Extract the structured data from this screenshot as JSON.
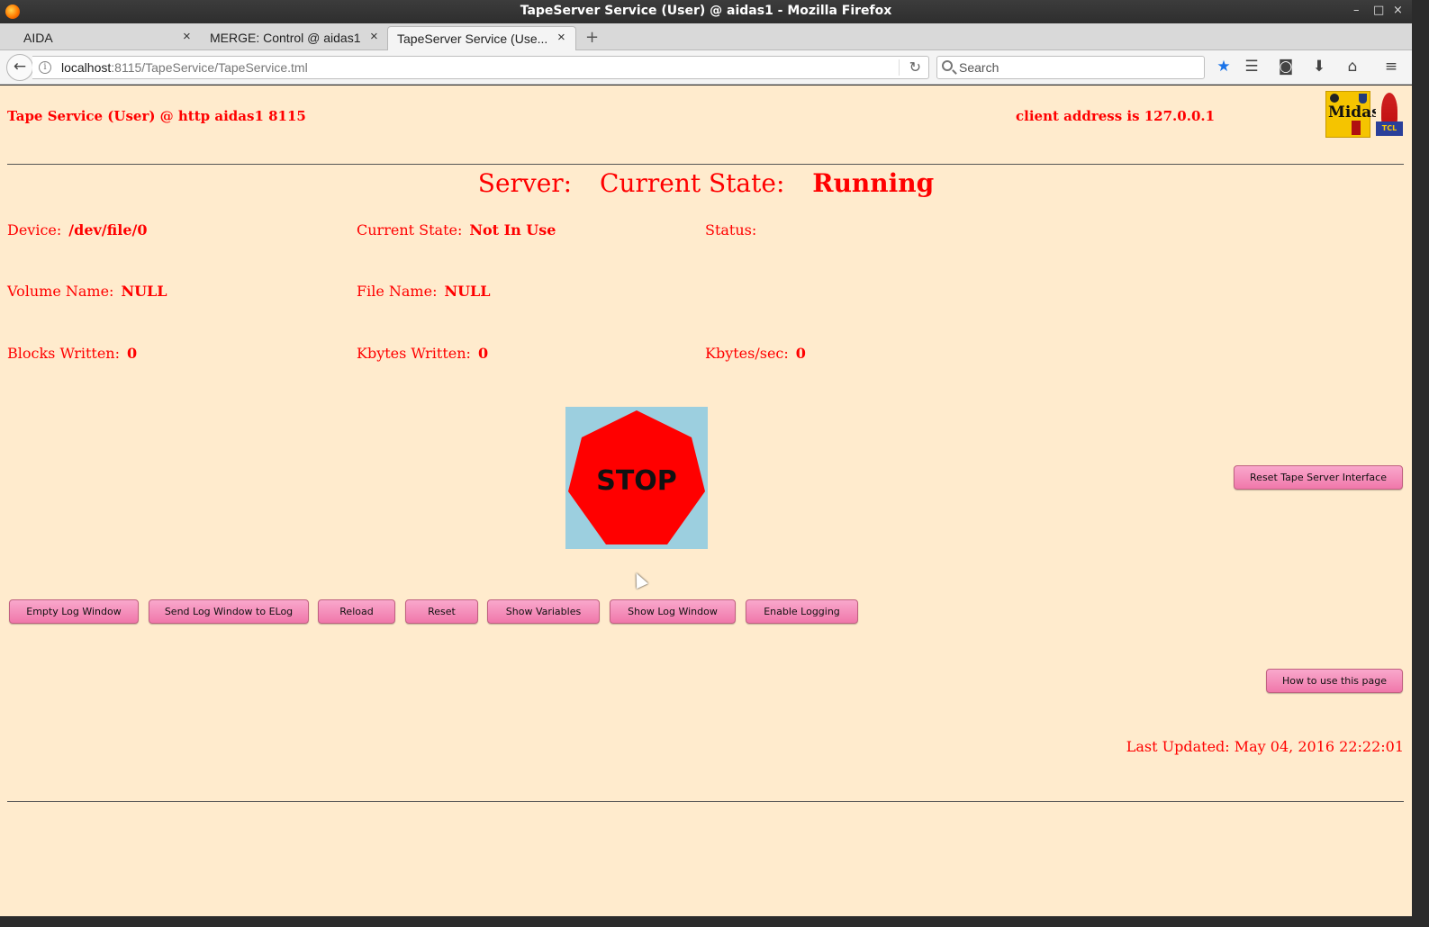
{
  "window": {
    "title": "TapeServer Service (User) @ aidas1 - Mozilla Firefox",
    "controls": [
      "–",
      "□",
      "×"
    ]
  },
  "tabs": [
    {
      "label": "AIDA",
      "active": false
    },
    {
      "label": "MERGE: Control @ aidas1",
      "active": false
    },
    {
      "label": "TapeServer Service (Use...",
      "active": true
    }
  ],
  "navbar": {
    "url_host": "localhost",
    "url_path": ":8115/TapeService/TapeService.tml",
    "search_placeholder": "Search"
  },
  "page": {
    "header_left": "Tape Service (User) @ http aidas1 8115",
    "header_right": "client address is 127.0.0.1",
    "logo_text": "Midas",
    "tcl_logo_text": "TCL",
    "server_label": "Server:",
    "current_state_label": "Current State:",
    "current_state_value": "Running",
    "fields": {
      "device": {
        "label": "Device:",
        "value": "/dev/file/0"
      },
      "device_state": {
        "label": "Current State:",
        "value": "Not In Use"
      },
      "status": {
        "label": "Status:",
        "value": ""
      },
      "volume_name": {
        "label": "Volume Name:",
        "value": "NULL"
      },
      "file_name": {
        "label": "File Name:",
        "value": "NULL"
      },
      "blocks_written": {
        "label": "Blocks Written:",
        "value": "0"
      },
      "kbytes_written": {
        "label": "Kbytes Written:",
        "value": "0"
      },
      "kbytes_sec": {
        "label": "Kbytes/sec:",
        "value": "0"
      }
    },
    "stop_label": "STOP",
    "buttons": {
      "reset_interface": "Reset Tape Server Interface",
      "empty_log": "Empty Log Window",
      "send_log": "Send Log Window to ELog",
      "reload": "Reload",
      "reset": "Reset",
      "show_variables": "Show Variables",
      "show_log": "Show Log Window",
      "enable_logging": "Enable Logging",
      "how_to_use": "How to use this page"
    },
    "last_updated": "Last Updated: May 04, 2016 22:22:01"
  },
  "colors": {
    "page_bg": "#ffebcd",
    "text": "#ff0000",
    "button": "#f077aa",
    "stop_bg": "#9ccfdf"
  }
}
